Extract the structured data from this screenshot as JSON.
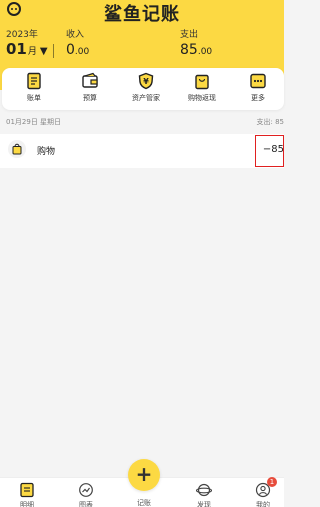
{
  "app": {
    "title": "鲨鱼记账",
    "accent_color": "#fcd943"
  },
  "header": {
    "year": "2023年",
    "month": "01",
    "month_suffix": "月",
    "caret": "▼",
    "income_label": "收入",
    "income_int": "0",
    "income_dec": ".00",
    "expense_label": "支出",
    "expense_int": "85",
    "expense_dec": ".00"
  },
  "toolbar": {
    "items": [
      {
        "label": "账单",
        "icon": "bill-icon"
      },
      {
        "label": "预算",
        "icon": "budget-icon"
      },
      {
        "label": "资产管家",
        "icon": "asset-shield-icon"
      },
      {
        "label": "购物返现",
        "icon": "shopping-bag-icon"
      },
      {
        "label": "更多",
        "icon": "more-icon"
      }
    ]
  },
  "records": {
    "date": "01月29日 星期日",
    "day_total": "支出: 85",
    "items": [
      {
        "category": "购物",
        "icon": "shopping-bag-icon",
        "amount": "−85"
      }
    ]
  },
  "tabbar": {
    "items": [
      {
        "label": "明细",
        "icon": "detail-icon"
      },
      {
        "label": "图表",
        "icon": "chart-icon"
      },
      {
        "label": "记账",
        "icon": "plus-icon"
      },
      {
        "label": "发现",
        "icon": "discover-icon"
      },
      {
        "label": "我的",
        "icon": "profile-icon"
      }
    ],
    "notification_count": "1"
  }
}
